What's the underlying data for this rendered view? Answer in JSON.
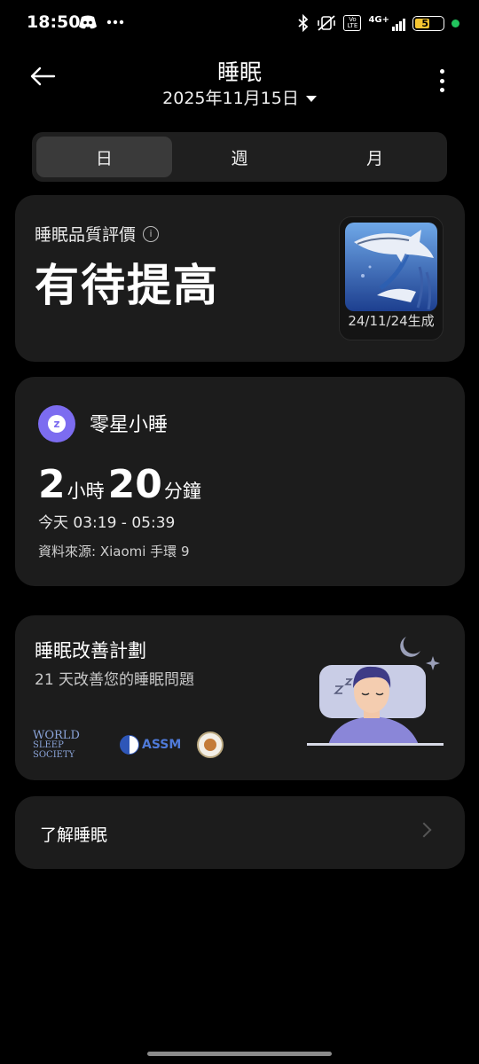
{
  "status_bar": {
    "time": "18:50",
    "network": "4G+",
    "volte": "Vo LTE",
    "battery": "52",
    "battery_level_percent": 52,
    "left_icons": [
      "discord-icon",
      "more-dots-icon"
    ],
    "right_icons": [
      "bluetooth-icon",
      "vibrate-off-icon",
      "volte-icon",
      "signal-icon",
      "battery-icon",
      "charging-dot-icon"
    ]
  },
  "header": {
    "title": "睡眠",
    "date": "2025年11月15日"
  },
  "tabs": [
    {
      "label": "日",
      "active": true
    },
    {
      "label": "週",
      "active": false
    },
    {
      "label": "月",
      "active": false
    }
  ],
  "quality": {
    "label": "睡眠品質評價",
    "value": "有待提高",
    "animal_date": "24/11/24生成"
  },
  "nap": {
    "title": "零星小睡",
    "hours": "2",
    "hours_unit": "小時",
    "minutes": "20",
    "minutes_unit": "分鐘",
    "time_range": "今天 03:19 - 05:39",
    "source": "資料來源: Xiaomi 手環 9"
  },
  "plan": {
    "title": "睡眠改善計劃",
    "subtitle": "21 天改善您的睡眠問題",
    "logo_wss_line1": "WORLD",
    "logo_wss_line2": "SLEEP SOCIETY",
    "logo_assm": "ASSM"
  },
  "learn": {
    "label": "了解睡眠"
  },
  "colors": {
    "background": "#000000",
    "card": "#1c1c1c",
    "accent_purple": "#7c6cf0",
    "battery": "#f5c531",
    "charge": "#22c55e"
  }
}
